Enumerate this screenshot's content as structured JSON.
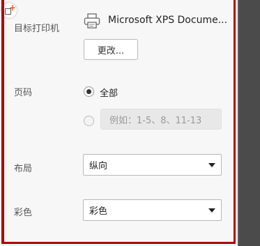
{
  "printer": {
    "label": "目标打印机",
    "name": "Microsoft XPS Docume...",
    "change_button": "更改..."
  },
  "pages": {
    "label": "页码",
    "all_option": "全部",
    "all_selected": true,
    "custom_placeholder": "例如：1-5、8、11-13"
  },
  "layout": {
    "label": "布局",
    "value": "纵向"
  },
  "color": {
    "label": "彩色",
    "value": "彩色"
  },
  "colors": {
    "highlight_border": "#b00000",
    "corner_plus": "#e85a0c",
    "right_strip": "#4b4b4b"
  }
}
